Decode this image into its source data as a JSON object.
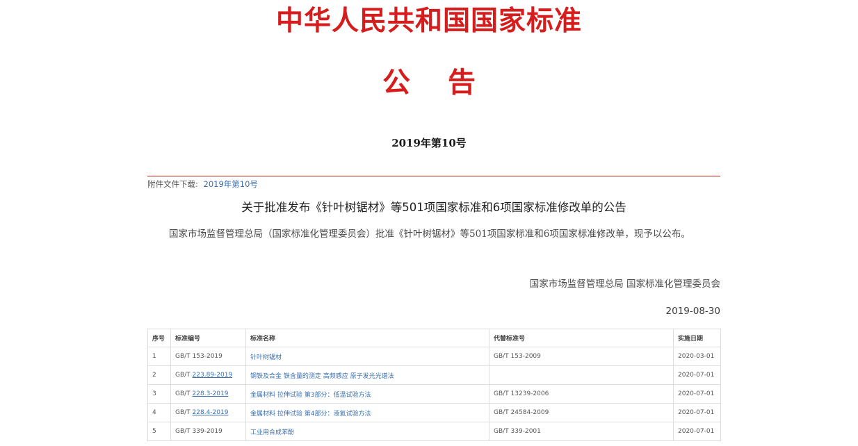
{
  "header": {
    "main_title": "中华人民共和国国家标准",
    "sub_title": "公告",
    "doc_number": "2019年第10号"
  },
  "attachment": {
    "label": "附件文件下载:",
    "link_text": "2019年第10号"
  },
  "notice": {
    "title": "关于批准发布《针叶树锯材》等501项国家标准和6项国家标准修改单的公告",
    "body": "国家市场监督管理总局（国家标准化管理委员会）批准《针叶树锯材》等501项国家标准和6项国家标准修改单，现予以公布。",
    "signer": "国家市场监督管理总局 国家标准化管理委员会",
    "date": "2019-08-30"
  },
  "table": {
    "headers": [
      "序号",
      "标准编号",
      "标准名称",
      "代替标准号",
      "实施日期"
    ],
    "rows": [
      {
        "no": "1",
        "code_prefix": "GB/T ",
        "code_link": "153-2019",
        "name": "针叶树锯材",
        "replaces": "GB/T 153-2009",
        "date": "2020-03-01"
      },
      {
        "no": "2",
        "code_prefix": "GB/T ",
        "code_link": "223.89-2019",
        "name": "钢铁及合金 铁含量的测定 高频感应 原子发光光谱法",
        "replaces": "",
        "date": "2020-07-01"
      },
      {
        "no": "3",
        "code_prefix": "GB/T ",
        "code_link": "228.3-2019",
        "name": "金属材料 拉伸试验 第3部分：低温试验方法",
        "replaces": "GB/T 13239-2006",
        "date": "2020-07-01"
      },
      {
        "no": "4",
        "code_prefix": "GB/T ",
        "code_link": "228.4-2019",
        "name": "金属材料 拉伸试验 第4部分：液氦试验方法",
        "replaces": "GB/T 24584-2009",
        "date": "2020-07-01"
      },
      {
        "no": "5",
        "code_prefix": "GB/T ",
        "code_link": "339-2019",
        "name": "工业用合成苯酚",
        "replaces": "GB/T 339-2001",
        "date": "2020-07-01"
      }
    ]
  }
}
